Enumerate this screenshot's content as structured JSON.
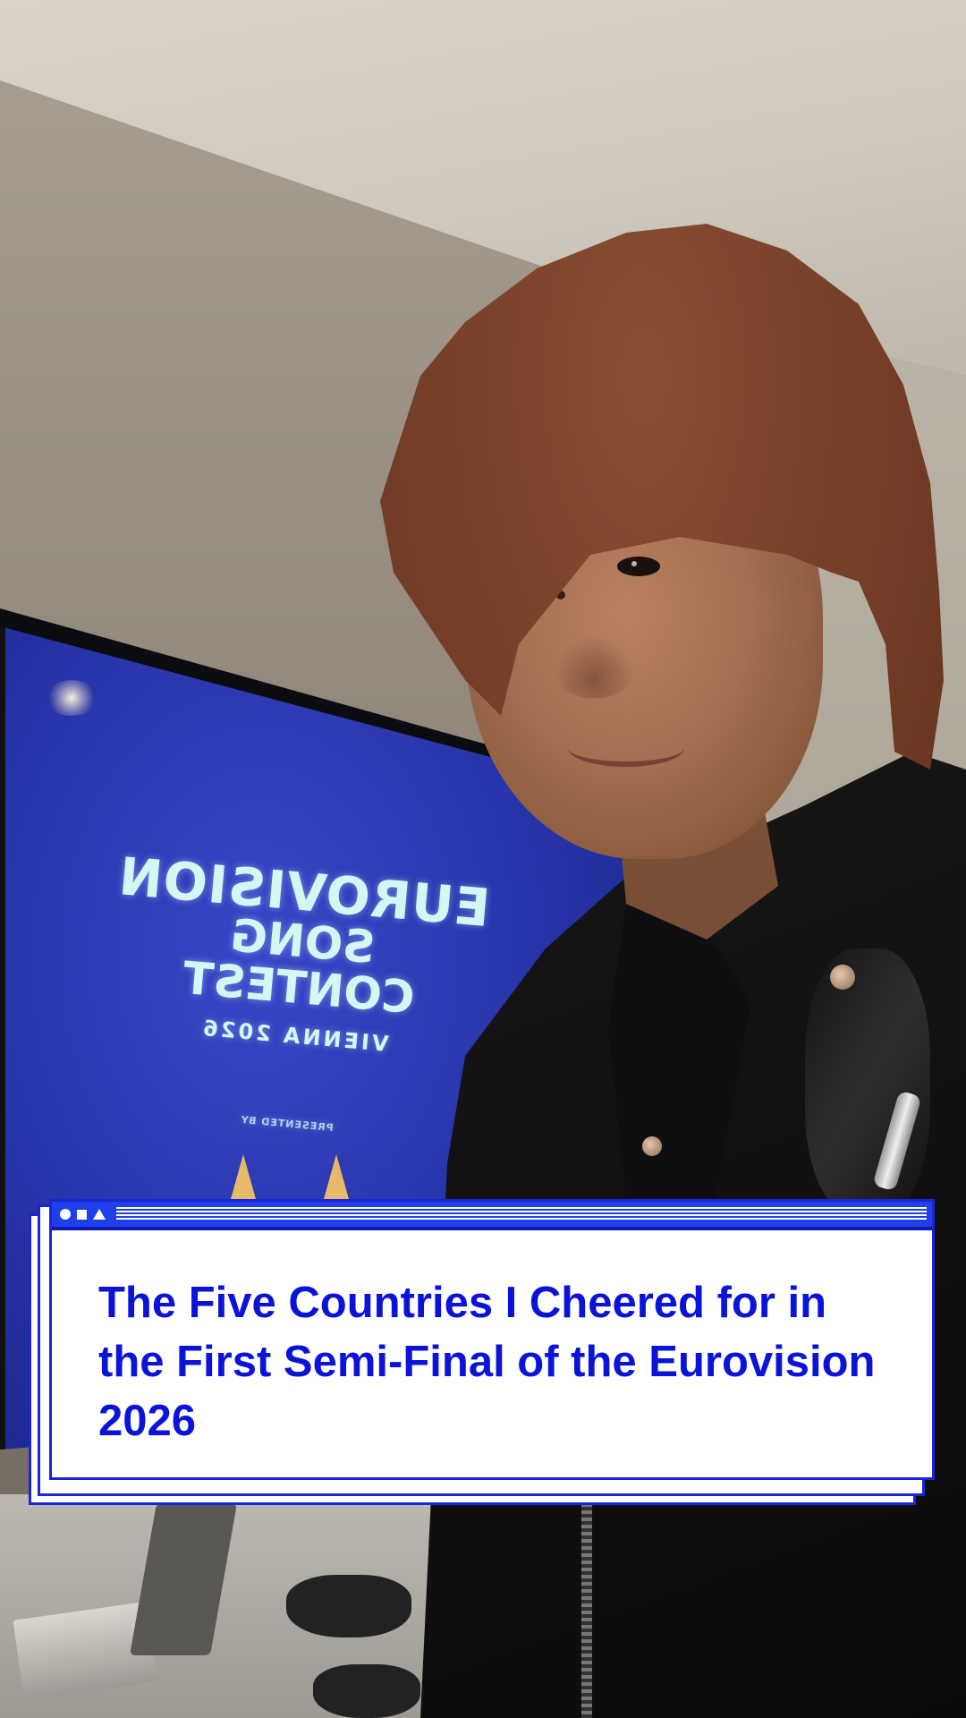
{
  "tv_logo": {
    "line1": "EUROVISION",
    "line2": "SONG CONTEST",
    "line3": "VIENNA 2026",
    "presented": "PRESENTED BY"
  },
  "caption": {
    "text": "The Five Countries I Cheered for in the First Semi-Final of the Eurovision 2026"
  },
  "colors": {
    "caption_text": "#0b13d9",
    "card_border": "#1a24d8",
    "titlebar": "#1f3fe8"
  },
  "titlebar_icons": [
    "circle-icon",
    "square-icon",
    "triangle-icon"
  ]
}
